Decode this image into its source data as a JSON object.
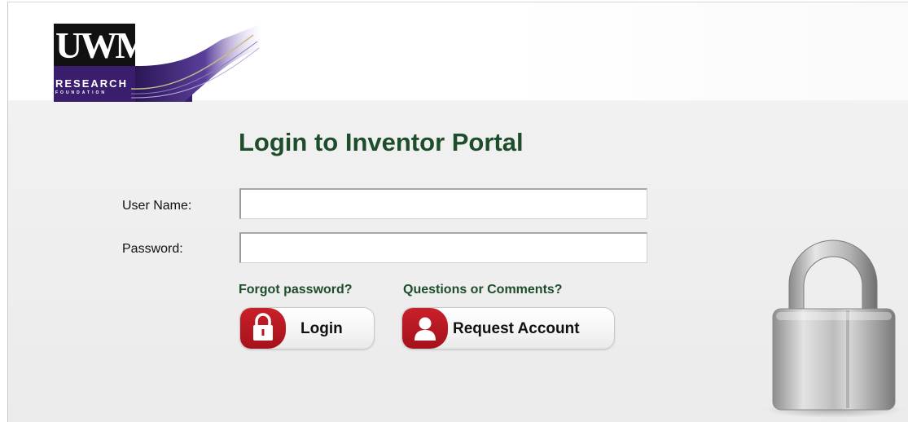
{
  "logo": {
    "primary": "UWM",
    "secondary": "RESEARCH",
    "tertiary": "FOUNDATION"
  },
  "page": {
    "title": "Login to Inventor Portal"
  },
  "form": {
    "username_label": "User Name:",
    "username_value": "",
    "password_label": "Password:",
    "password_value": ""
  },
  "links": {
    "forgot_password": "Forgot password?",
    "questions": "Questions or Comments?"
  },
  "buttons": {
    "login": "Login",
    "request_account": "Request Account"
  },
  "icons": {
    "login": "padlock-icon",
    "request_account": "user-icon",
    "decoration": "large-padlock-icon"
  },
  "colors": {
    "title_green": "#1e4d2b",
    "button_red": "#b5161f",
    "logo_purple": "#3b1d6e"
  }
}
